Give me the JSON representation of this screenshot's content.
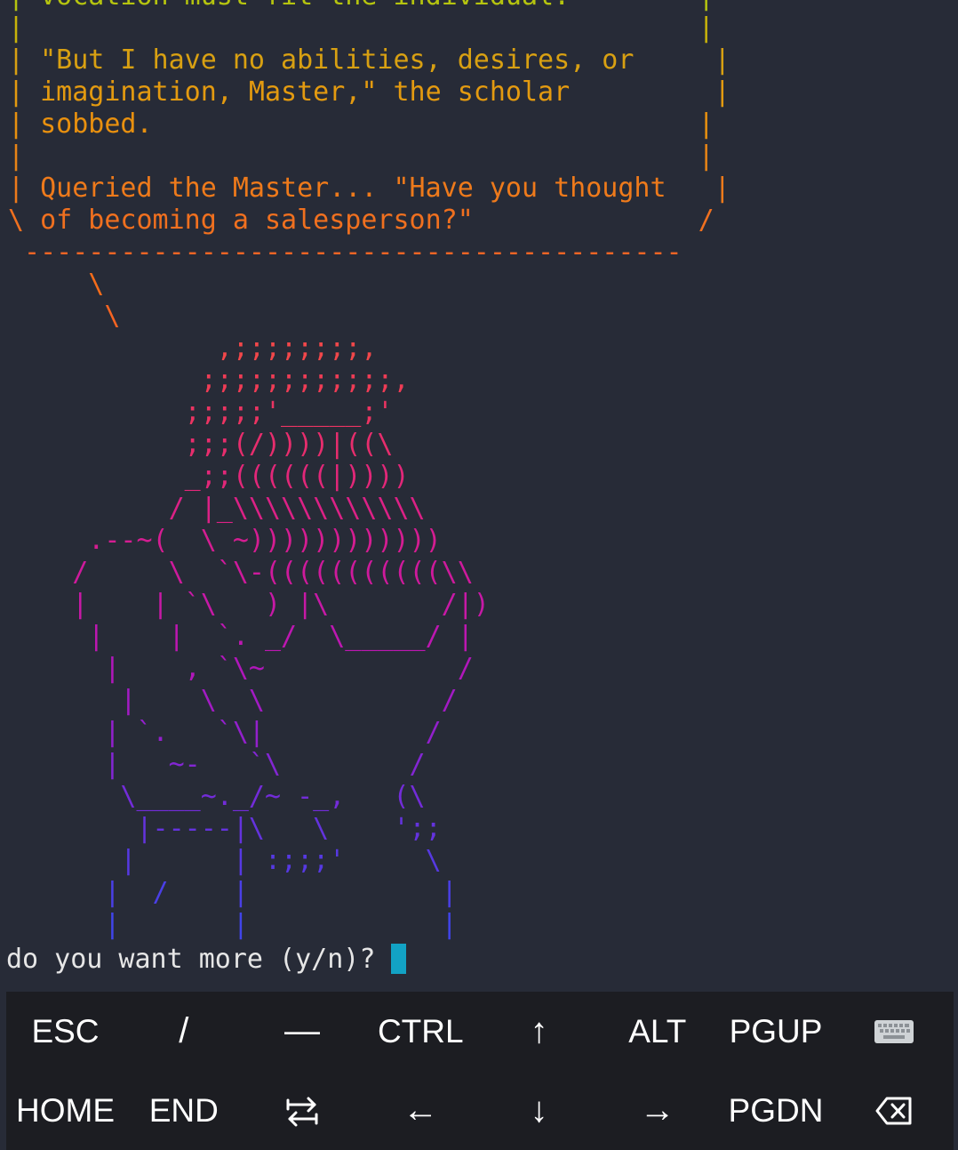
{
  "terminal": {
    "lines": [
      {
        "text": "| vocation must fit the individual.        |",
        "color": "#b5c40f"
      },
      {
        "text": "|                                          |",
        "color": "#c8b30a"
      },
      {
        "text": "| \"But I have no abilities, desires, or     |",
        "color": "#d8a012"
      },
      {
        "text": "| imagination, Master,\" the scholar         |",
        "color": "#e39a10"
      },
      {
        "text": "| sobbed.                                  |",
        "color": "#e8900f"
      },
      {
        "text": "|                                          |",
        "color": "#e88416"
      },
      {
        "text": "| Queried the Master... \"Have you thought   |",
        "color": "#ee7a1b"
      },
      {
        "text": "\\ of becoming a salesperson?\"              /",
        "color": "#f0701f"
      },
      {
        "text": " ----------------------------------------- ",
        "color": "#f26525"
      },
      {
        "text": "     \\",
        "color": "#f56c1a"
      },
      {
        "text": "      \\",
        "color": "#f56422"
      },
      {
        "text": "             ,;;;;;;;;,",
        "color": "#f2474a"
      },
      {
        "text": "            ;;;;;;;;;;;;,",
        "color": "#ef3c55"
      },
      {
        "text": "           ;;;;;'_____;'",
        "color": "#eb3462"
      },
      {
        "text": "           ;;;(/))))|((\\",
        "color": "#e72d6d"
      },
      {
        "text": "           _;;((((((|))))",
        "color": "#e22779"
      },
      {
        "text": "          / |_\\\\\\\\\\\\\\\\\\\\\\\\",
        "color": "#dc2186"
      },
      {
        "text": "     .--~(  \\ ~))))))))))))",
        "color": "#d51d92"
      },
      {
        "text": "    /     \\  `\\-(((((((((((\\\\",
        "color": "#ce1a9c"
      },
      {
        "text": "    |    | `\\   ) |\\       /|)",
        "color": "#c719a6"
      },
      {
        "text": "     |    |  `. _/  \\_____/ |",
        "color": "#bd17b1"
      },
      {
        "text": "      |    , `\\~            /",
        "color": "#b117bb"
      },
      {
        "text": "       |    \\  \\           /",
        "color": "#a31bc4"
      },
      {
        "text": "      | `.   `\\|          /",
        "color": "#9320cc"
      },
      {
        "text": "      |   ~-   `\\        /",
        "color": "#8326d3"
      },
      {
        "text": "       \\____~._/~ -_,   (\\",
        "color": "#732cd9"
      },
      {
        "text": "        |-----|\\   \\    ';;",
        "color": "#6433de"
      },
      {
        "text": "       |      | :;;;'     \\",
        "color": "#5639e2"
      },
      {
        "text": "      |  /    |            |",
        "color": "#4a3fe6"
      },
      {
        "text": "      |       |            |",
        "color": "#4044e9"
      }
    ],
    "prompt": "do you want more (y/n)?"
  },
  "extra_keys": {
    "row1": [
      {
        "label": "ESC",
        "name": "key-esc"
      },
      {
        "label": "/",
        "name": "key-slash"
      },
      {
        "label": "—",
        "name": "key-dash"
      },
      {
        "label": "CTRL",
        "name": "key-ctrl"
      },
      {
        "label": "↑",
        "name": "key-up"
      },
      {
        "label": "ALT",
        "name": "key-alt"
      },
      {
        "label": "PGUP",
        "name": "key-pgup"
      },
      {
        "label": "",
        "name": "key-keyboard",
        "icon": "keyboard-icon"
      }
    ],
    "row2": [
      {
        "label": "HOME",
        "name": "key-home"
      },
      {
        "label": "END",
        "name": "key-end"
      },
      {
        "label": "",
        "name": "key-tab",
        "icon": "swap-arrows-icon"
      },
      {
        "label": "←",
        "name": "key-left"
      },
      {
        "label": "↓",
        "name": "key-down"
      },
      {
        "label": "→",
        "name": "key-right"
      },
      {
        "label": "PGDN",
        "name": "key-pgdn"
      },
      {
        "label": "",
        "name": "key-backspace",
        "icon": "backspace-icon"
      }
    ]
  },
  "colors": {
    "background": "#272b37",
    "keys_background": "#1c1d22",
    "cursor": "#12a2c4"
  }
}
